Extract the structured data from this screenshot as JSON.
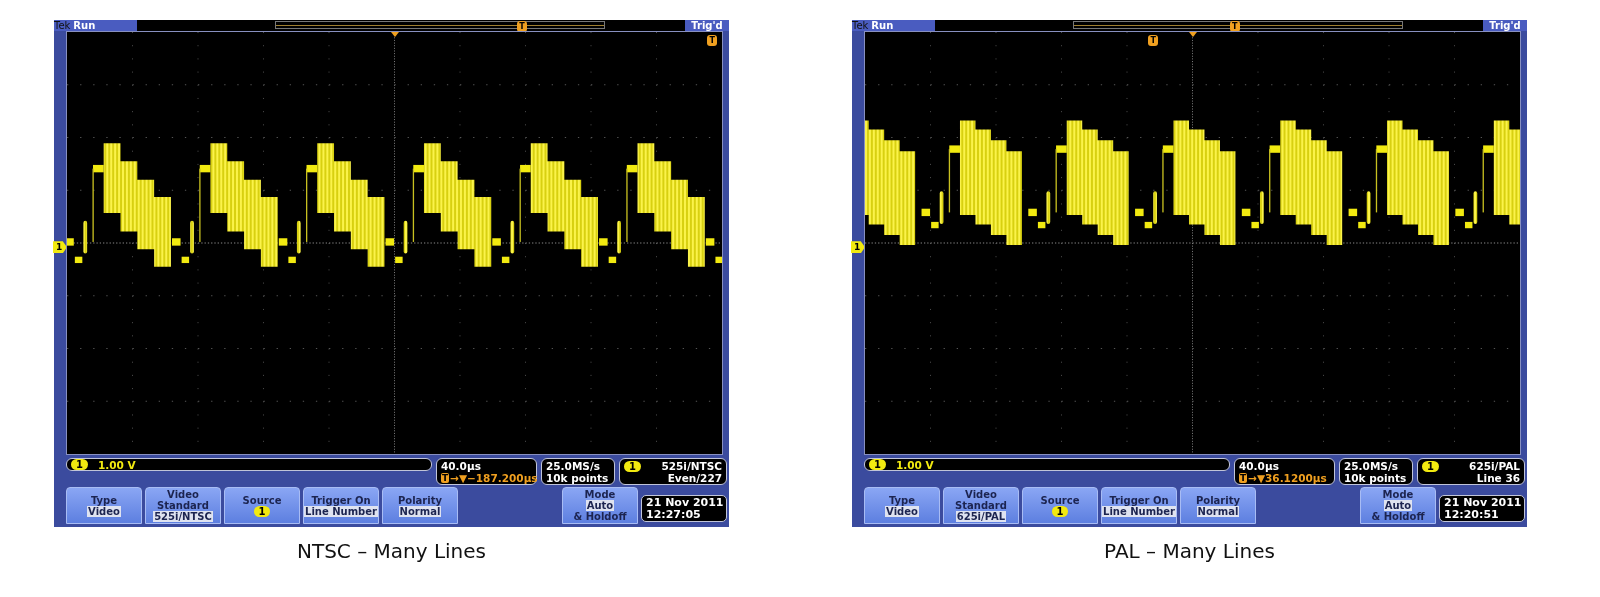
{
  "scopes": [
    {
      "brand": "Tek",
      "run_state": "Run",
      "trigger_state": "Trig'd",
      "record_bar": {
        "trigger_label": "T",
        "level": 0.75
      },
      "screen_trigger": {
        "label": "T",
        "level": 0.985
      },
      "waveform": {
        "kind": "ntsc"
      },
      "ground_marker": "1",
      "channel_readout": {
        "badge": "1",
        "scale": "1.00 V"
      },
      "timebase": {
        "scale": "40.0µs",
        "delay_badge": "T",
        "delay": "→▼−187.200µs"
      },
      "acquisition": {
        "rate": "25.0MS/s",
        "length": "10k points"
      },
      "trigger_readout": {
        "badge": "1",
        "standard": "525i/NTSC",
        "line": "Even/227"
      },
      "buttons": [
        {
          "kind": "value",
          "label": "Type",
          "value": "Video"
        },
        {
          "kind": "value",
          "label": "Video Standard",
          "value": "525i/NTSC"
        },
        {
          "kind": "badge",
          "label": "Source",
          "value": "1"
        },
        {
          "kind": "value",
          "label": "Trigger On",
          "value": "Line Number"
        },
        {
          "kind": "value",
          "label": "Polarity",
          "value": "Normal"
        },
        {
          "kind": "mode",
          "label": "Mode",
          "value": "Auto",
          "note": "& Holdoff"
        }
      ],
      "date": "21 Nov 2011",
      "time": "12:27:05",
      "caption": "NTSC – Many Lines"
    },
    {
      "brand": "Tek",
      "run_state": "Run",
      "trigger_state": "Trig'd",
      "record_bar": {
        "trigger_label": "T",
        "level": 0.49
      },
      "screen_trigger": {
        "label": "T",
        "level": 0.44
      },
      "waveform": {
        "kind": "pal"
      },
      "ground_marker": "1",
      "channel_readout": {
        "badge": "1",
        "scale": "1.00 V"
      },
      "timebase": {
        "scale": "40.0µs",
        "delay_badge": "T",
        "delay": "→▼36.1200µs"
      },
      "acquisition": {
        "rate": "25.0MS/s",
        "length": "10k points"
      },
      "trigger_readout": {
        "badge": "1",
        "standard": "625i/PAL",
        "line": "Line 36"
      },
      "buttons": [
        {
          "kind": "value",
          "label": "Type",
          "value": "Video"
        },
        {
          "kind": "value",
          "label": "Video Standard",
          "value": "625i/PAL"
        },
        {
          "kind": "badge",
          "label": "Source",
          "value": "1"
        },
        {
          "kind": "value",
          "label": "Trigger On",
          "value": "Line Number"
        },
        {
          "kind": "value",
          "label": "Polarity",
          "value": "Normal"
        },
        {
          "kind": "mode",
          "label": "Mode",
          "value": "Auto",
          "note": "& Holdoff"
        }
      ],
      "date": "21 Nov 2011",
      "time": "12:20:51",
      "caption": "PAL – Many Lines"
    }
  ]
}
